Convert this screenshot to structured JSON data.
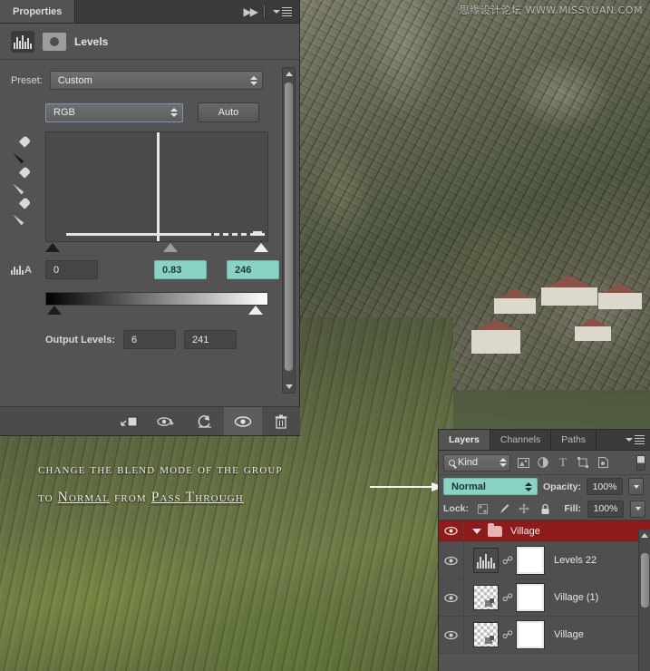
{
  "watermark": "思缘设计论坛 WWW.MISSYUAN.COM",
  "annotation": {
    "line1": "change the blend mode of the group",
    "line2_prefix": "to ",
    "line2_em1": "Normal",
    "line2_mid": " from ",
    "line2_em2": "Pass Through"
  },
  "properties": {
    "tab_label": "Properties",
    "panel_title": "Levels",
    "icons": {
      "collapse": "collapse-to-icons-icon",
      "menu": "panel-menu-icon",
      "adjustment": "levels-adjustment-icon",
      "mask": "layer-mask-icon"
    },
    "preset": {
      "label": "Preset:",
      "value": "Custom"
    },
    "channel": {
      "value": "RGB"
    },
    "auto_button": "Auto",
    "eyedroppers": [
      "set-black-point-eyedropper",
      "set-gray-point-eyedropper",
      "set-white-point-eyedropper"
    ],
    "input_levels": {
      "shadow": "0",
      "midtone": "0.83",
      "highlight": "246"
    },
    "output_levels": {
      "label": "Output Levels:",
      "black": "6",
      "white": "241"
    },
    "footer_buttons": [
      "clip-to-layer-icon",
      "view-previous-state-icon",
      "reset-adjustment-icon",
      "toggle-layer-visibility-icon",
      "delete-adjustment-layer-icon"
    ]
  },
  "layers": {
    "tabs": [
      {
        "label": "Layers",
        "active": true
      },
      {
        "label": "Channels",
        "active": false
      },
      {
        "label": "Paths",
        "active": false
      }
    ],
    "filter": {
      "kind": "Kind",
      "icons": [
        "filter-pixel-layers-icon",
        "filter-adjustment-layers-icon",
        "filter-type-layers-icon",
        "filter-shape-layers-icon",
        "filter-smart-object-layers-icon"
      ],
      "toggle": "filter-enable-toggle"
    },
    "blend_mode": "Normal",
    "opacity": {
      "label": "Opacity:",
      "value": "100%"
    },
    "lock": {
      "label": "Lock:",
      "icons": [
        "lock-transparent-pixels-icon",
        "lock-image-pixels-icon",
        "lock-position-icon",
        "lock-all-icon"
      ]
    },
    "fill": {
      "label": "Fill:",
      "value": "100%"
    },
    "rows": [
      {
        "type": "group",
        "name": "Village",
        "selected": true,
        "visible": true,
        "expanded": true
      },
      {
        "type": "adjustment",
        "name": "Levels 22",
        "visible": true,
        "linked": true
      },
      {
        "type": "pixel",
        "name": "Village (1)",
        "visible": true,
        "linked": true
      },
      {
        "type": "pixel",
        "name": "Village",
        "visible": true,
        "linked": true
      }
    ]
  },
  "colors": {
    "teal_highlight": "#8ad3c4",
    "group_selected": "#8c1b1b",
    "panel_bg": "#535353"
  }
}
